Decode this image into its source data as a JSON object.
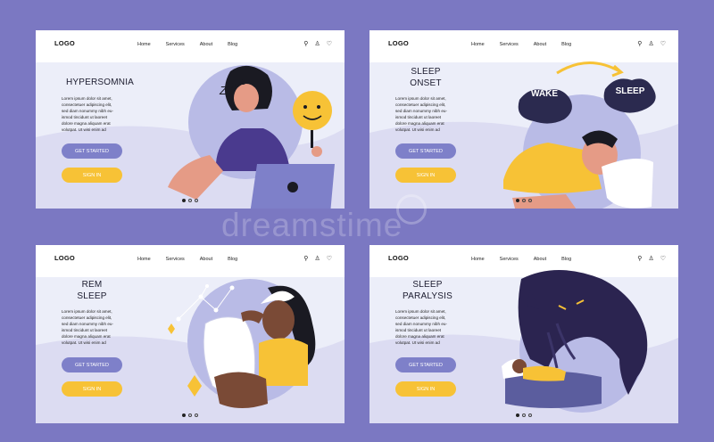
{
  "nav": {
    "logo": "LOGO",
    "links": [
      "Home",
      "Services",
      "About",
      "Blog"
    ],
    "icons": [
      "search-icon",
      "user-icon",
      "heart-icon"
    ]
  },
  "lorem": [
    "Lorem ipsum dolor sit amet,",
    "consectetuer adipiscing elit,",
    "sed diam nonummy nibh eu-",
    "ismod  tincidunt  ut  laoreet",
    "dolore magna aliquam erat",
    "volutpat.  Ut  wisi  enim  ad"
  ],
  "buttons": {
    "primary": "GET STARTED",
    "secondary": "SIGN IN"
  },
  "cards": [
    {
      "title_lines": [
        "HYPERSOMNIA"
      ],
      "illustration": "person-at-laptop-with-smiley-mask"
    },
    {
      "title_lines": [
        "SLEEP",
        "ONSET"
      ],
      "illustration": "person-sleeping-wake-to-sleep",
      "bubbles": {
        "wake": "WAKE",
        "sleep": "SLEEP"
      }
    },
    {
      "title_lines": [
        "REM",
        "SLEEP"
      ],
      "illustration": "woman-hugging-pillow-dreaming"
    },
    {
      "title_lines": [
        "SLEEP",
        "PARALYSIS"
      ],
      "illustration": "sleeper-with-shadow-monster"
    }
  ],
  "pagination": {
    "count": 3,
    "active": 1
  },
  "watermark": "dreamstime",
  "colors": {
    "background": "#7b78c2",
    "accent_purple": "#7e80c9",
    "accent_yellow": "#f7c236",
    "card_bg": "#eceef9"
  }
}
